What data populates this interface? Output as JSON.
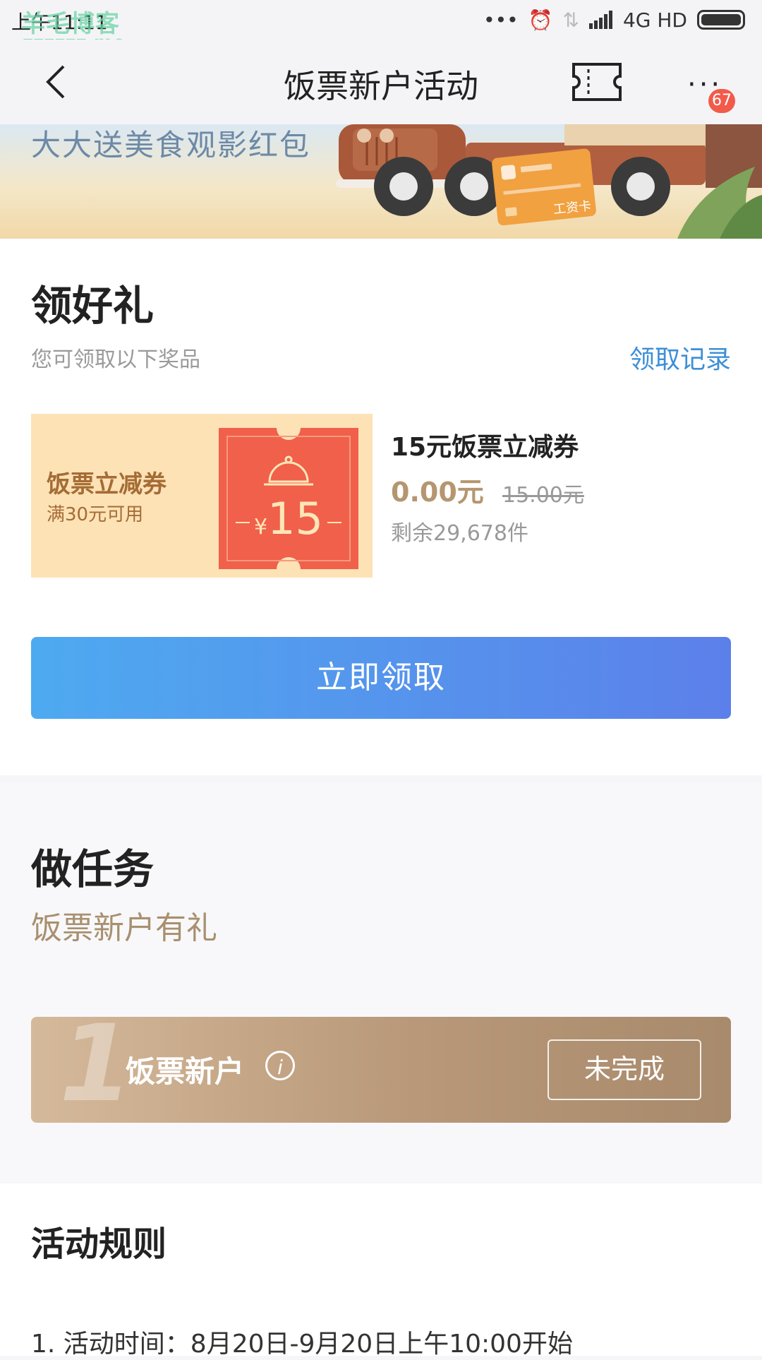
{
  "status_bar": {
    "time": "上午11:11",
    "watermark": "羊毛博客",
    "watermark_url": "zzzzzz.me",
    "network": "4G HD"
  },
  "nav": {
    "title": "饭票新户活动",
    "badge_count": "67",
    "icons": [
      "back-chevron-icon",
      "ticket-icon",
      "more-icon"
    ]
  },
  "banner": {
    "text": "大大送美食观影红包",
    "card_label": "工资卡"
  },
  "gift_section": {
    "title": "领好礼",
    "subtitle": "您可领取以下奖品",
    "records_link": "领取记录",
    "coupon": {
      "name": "饭票立减券",
      "condition": "满30元可用",
      "currency": "¥",
      "amount": "15"
    },
    "prize": {
      "title": "15元饭票立减券",
      "price": "0.00元",
      "original_price": "15.00元",
      "stock": "剩余29,678件"
    },
    "claim_button": "立即领取"
  },
  "task_section": {
    "title": "做任务",
    "subtitle": "饭票新户有礼",
    "task": {
      "number": "1",
      "name": "饭票新户",
      "info_symbol": "i",
      "status": "未完成"
    }
  },
  "rules_section": {
    "title": "活动规则",
    "first_rule": "1. 活动时间：8月20日-9月20日上午10:00开始"
  },
  "colors": {
    "accent_blue": "#4eaaf0",
    "gold": "#b59670",
    "badge_red": "#f25a4a",
    "coupon_red": "#f0604a"
  }
}
